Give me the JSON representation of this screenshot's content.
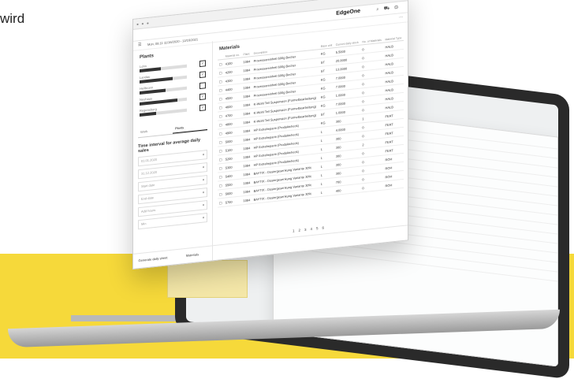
{
  "caption": "wird",
  "app": {
    "brand": "EdgeOne",
    "date_range": "Mon, 08.11 11/16/2020 - 12/16/2021"
  },
  "sidebar": {
    "title": "Plants",
    "plants": [
      {
        "label": "Lohn",
        "level": 0.45,
        "checked": true
      },
      {
        "label": "Landau",
        "level": 0.7,
        "checked": true
      },
      {
        "label": "Heilbronn",
        "level": 0.55,
        "checked": false
      },
      {
        "label": "Neuhaus",
        "level": 0.8,
        "checked": true
      },
      {
        "label": "Regensburg",
        "level": 0.35,
        "checked": true
      }
    ],
    "tabs": [
      "Work",
      "Plants"
    ],
    "interval_title": "Time interval for average daily sales",
    "fields": [
      {
        "placeholder": "01.01.2020"
      },
      {
        "placeholder": "31.12.2020"
      },
      {
        "placeholder": "Start date"
      },
      {
        "placeholder": "End date"
      },
      {
        "placeholder": "Add hours"
      },
      {
        "placeholder": "Min"
      }
    ],
    "footer": [
      "Generate daily sheet",
      "Materials"
    ]
  },
  "main": {
    "title": "Materials",
    "columns": [
      "",
      "Material no.",
      "Plant",
      "Description",
      "Base unit",
      "Current daily stock",
      "No. of Materials",
      "Material Type"
    ],
    "rows": [
      [
        "",
        "4100",
        "1084",
        "Prozessoreinheit 600g Becher",
        "KG",
        "5.5000",
        "0",
        "HALB"
      ],
      [
        "",
        "4200",
        "1084",
        "Prozessoreinheit 600g Becher",
        "ST",
        "20.0000",
        "0",
        "HALB"
      ],
      [
        "",
        "4300",
        "1084",
        "Prozessoreinheit 600g Becher",
        "ST",
        "13.0000",
        "0",
        "HALB"
      ],
      [
        "",
        "4400",
        "1084",
        "Prozessoreinheit 600g Becher",
        "KG",
        "7.0000",
        "0",
        "HALB"
      ],
      [
        "",
        "4500",
        "1084",
        "Prozessoreinheit 600g Becher",
        "KG",
        "7.0000",
        "0",
        "HALB"
      ],
      [
        "",
        "4600",
        "1084",
        "K-Wohl Teil Suspension (Formelbearbeitung)",
        "KG",
        "1.0000",
        "0",
        "HALB"
      ],
      [
        "",
        "4700",
        "1084",
        "K-Wohl Teil Suspension (Formelbearbeitung)",
        "KG",
        "7.0000",
        "0",
        "HALB"
      ],
      [
        "",
        "4800",
        "1084",
        "K-Wohl Teil Suspension (Formelbearbeitung)",
        "ST",
        "1.0000",
        "0",
        "HALB"
      ],
      [
        "",
        "4900",
        "1084",
        "HP Extraheparin (Produktcheck)",
        "KG",
        "300",
        "1",
        "FERT"
      ],
      [
        "",
        "5000",
        "1084",
        "HP Extraheparin (Produktcheck)",
        "L",
        "4.0000",
        "0",
        "FERT"
      ],
      [
        "",
        "5100",
        "1084",
        "HP Extraheparin (Produktcheck)",
        "L",
        "300",
        "0",
        "FERT"
      ],
      [
        "",
        "5200",
        "1084",
        "HP Extraheparin (Produktcheck)",
        "L",
        "300",
        "2",
        "FERT"
      ],
      [
        "",
        "5300",
        "1084",
        "HP Extraheparin (Produktcheck)",
        "L",
        "300",
        "0",
        "FERT"
      ],
      [
        "",
        "5400",
        "1084",
        "BAYTIX - Dosiergesenkung Variante 30%",
        "L",
        "300",
        "0",
        "ROH"
      ],
      [
        "",
        "5500",
        "1084",
        "BAYTIX - Dosiergesenkung Variante 30%",
        "L",
        "300",
        "0",
        "ROH"
      ],
      [
        "",
        "5600",
        "1084",
        "BAYTIX - Dosiergesenkung Variante 30%",
        "L",
        "700",
        "0",
        "ROH"
      ],
      [
        "",
        "5700",
        "1084",
        "BAYTIX - Dosiergesenkung Variante 30%",
        "L",
        "400",
        "0",
        "ROH"
      ]
    ],
    "pager": [
      "1",
      "2",
      "3",
      "4",
      "5",
      "6"
    ]
  }
}
